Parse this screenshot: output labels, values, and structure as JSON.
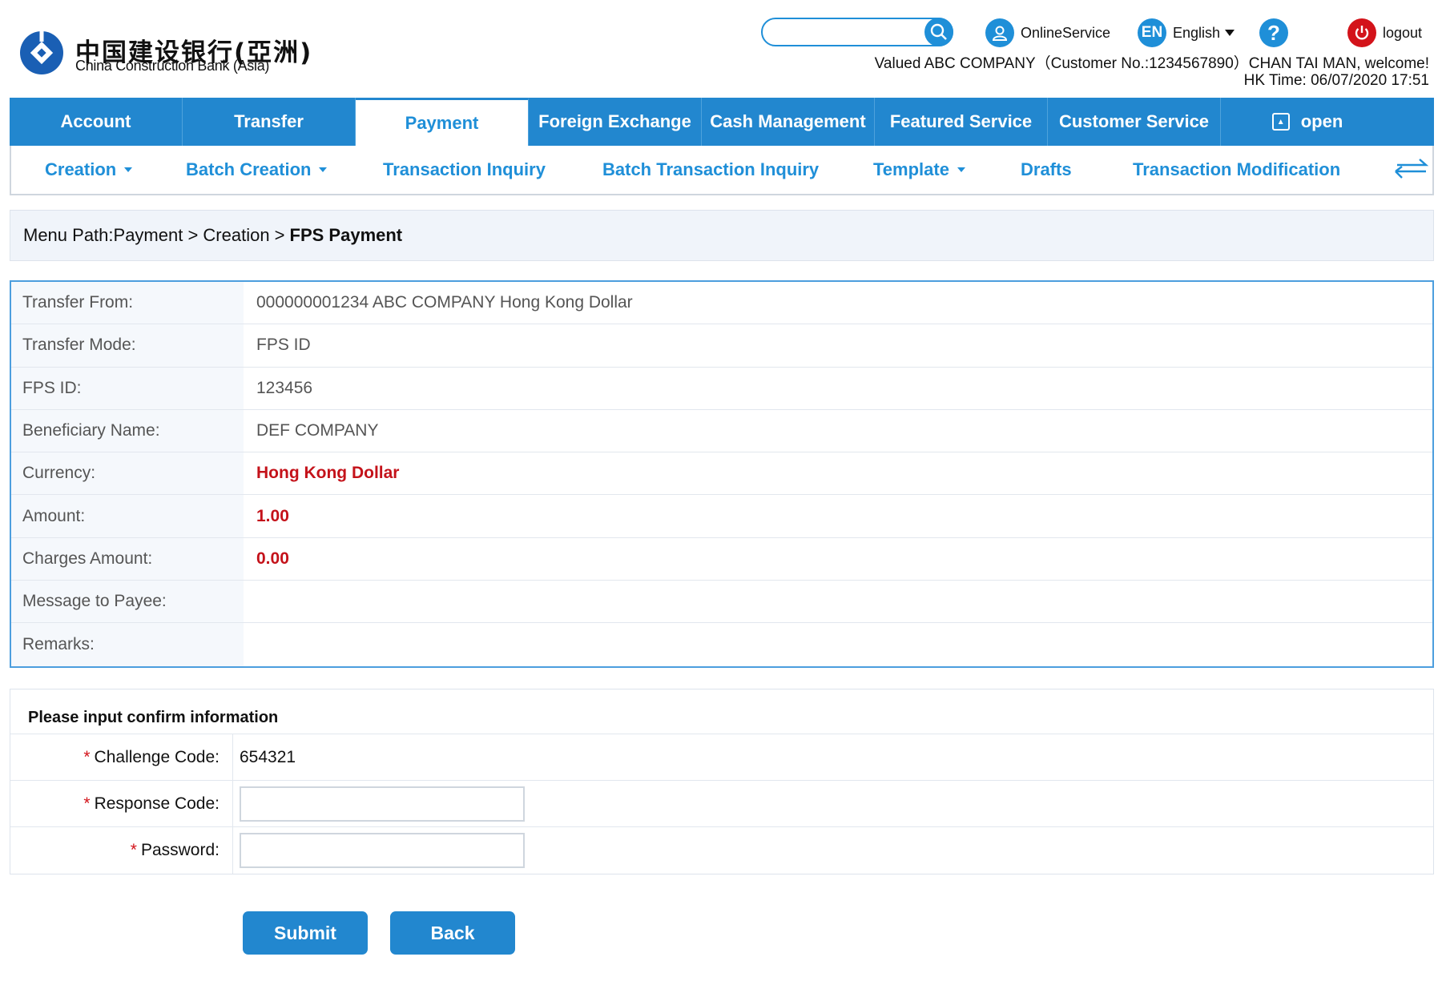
{
  "brand": {
    "chinese_name": "中国建设银行(亞洲)",
    "english_name": "China Construction Bank (Asia)"
  },
  "header": {
    "search_placeholder": "",
    "online_service": "OnlineService",
    "language_badge": "EN",
    "language": "English",
    "help": "?",
    "logout": "logout",
    "welcome": "Valued ABC COMPANY（Customer No.:1234567890）CHAN TAI MAN, welcome!",
    "hk_time": "HK Time: 06/07/2020 17:51"
  },
  "main_nav": {
    "tabs": [
      "Account",
      "Transfer",
      "Payment",
      "Foreign Exchange",
      "Cash Management",
      "Featured Service",
      "Customer Service",
      "open"
    ],
    "active": "Payment"
  },
  "sub_nav": {
    "items": [
      "Creation",
      "Batch Creation",
      "Transaction Inquiry",
      "Batch Transaction Inquiry",
      "Template",
      "Drafts",
      "Transaction Modification"
    ]
  },
  "breadcrumb": {
    "prefix": "Menu Path:Payment > Creation >",
    "current": "FPS Payment"
  },
  "details": {
    "rows": [
      {
        "label": "Transfer From:",
        "value": "000000001234 ABC COMPANY Hong Kong Dollar"
      },
      {
        "label": "Transfer Mode:",
        "value": "FPS ID"
      },
      {
        "label": "FPS ID:",
        "value": "123456"
      },
      {
        "label": "Beneficiary Name:",
        "value": "DEF COMPANY"
      },
      {
        "label": "Currency:",
        "value": "Hong Kong Dollar"
      },
      {
        "label": "Amount:",
        "value": "1.00"
      },
      {
        "label": "Charges Amount:",
        "value": "0.00"
      },
      {
        "label": "Message to Payee:",
        "value": ""
      },
      {
        "label": "Remarks:",
        "value": ""
      }
    ]
  },
  "confirm": {
    "title": "Please input confirm information",
    "required_mark": "*",
    "challenge_label": "Challenge Code:",
    "challenge_value": "654321",
    "response_label": "Response Code:",
    "response_value": "",
    "password_label": "Password:",
    "password_value": ""
  },
  "actions": {
    "submit": "Submit",
    "back": "Back"
  },
  "colors": {
    "primary_blue": "#2287cf",
    "highlight_red": "#c4121a",
    "logout_red": "#d3131a"
  }
}
